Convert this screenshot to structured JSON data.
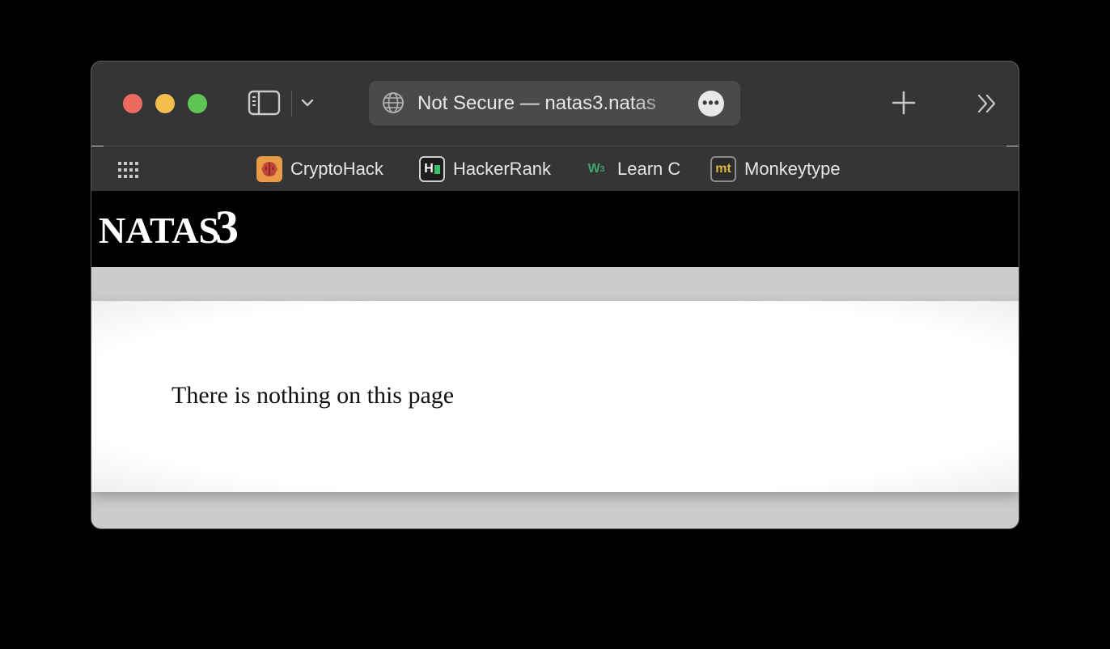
{
  "browser": {
    "address_bar": {
      "text": "Not Secure — natas3.natas",
      "more_label": "•••"
    },
    "bookmarks": [
      {
        "label": "CryptoHack",
        "icon": "brain-icon"
      },
      {
        "label": "HackerRank",
        "icon": "hackerrank-icon",
        "glyph": "H"
      },
      {
        "label": "Learn C",
        "icon": "w3schools-icon",
        "glyph": "W"
      },
      {
        "label": "Monkeytype",
        "icon": "monkeytype-icon",
        "glyph": "mt"
      }
    ],
    "colors": {
      "toolbar": "#353537",
      "close": "#ec6a5e",
      "minimize": "#f4bf4f",
      "zoom": "#61c554"
    }
  },
  "page": {
    "title": "NATAS",
    "level": "3",
    "content": "There is nothing on this page"
  }
}
